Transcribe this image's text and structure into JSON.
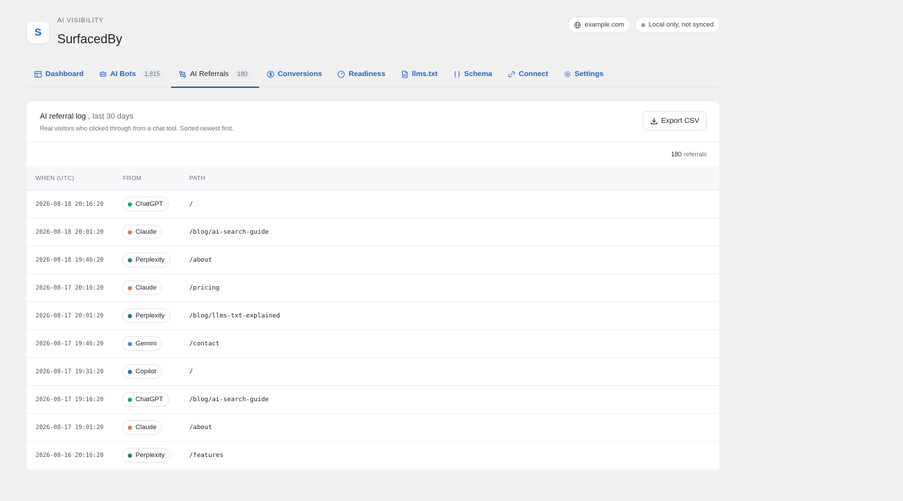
{
  "header": {
    "logo_letter": "S",
    "eyebrow": "AI VISIBILITY",
    "brand": "SurfacedBy",
    "domain_chip": "example.com",
    "sync_chip": "Local only, not synced"
  },
  "tabs": [
    {
      "label": "Dashboard",
      "icon": "layout-icon"
    },
    {
      "label": "AI Bots",
      "count": "1,815",
      "icon": "bot-icon"
    },
    {
      "label": "AI Referrals",
      "count": "180",
      "icon": "referral-icon",
      "active": true
    },
    {
      "label": "Conversions",
      "icon": "dollar-icon"
    },
    {
      "label": "Readiness",
      "icon": "gauge-icon"
    },
    {
      "label": "llms.txt",
      "icon": "file-icon"
    },
    {
      "label": "Schema",
      "icon": "braces-icon"
    },
    {
      "label": "Connect",
      "icon": "link-icon"
    },
    {
      "label": "Settings",
      "icon": "gear-icon"
    }
  ],
  "card": {
    "title": "AI referral log",
    "title_suffix": ", last 30 days",
    "description": "Real visitors who clicked through from a chat tool. Sorted newest first.",
    "export_label": "Export CSV",
    "count_value": "180",
    "count_label": "referrals"
  },
  "table": {
    "headers": {
      "when": "WHEN (UTC)",
      "from": "FROM",
      "path": "PATH"
    },
    "rows": [
      {
        "when": "2026-08-18 20:16:20",
        "from": "ChatGPT",
        "path": "/"
      },
      {
        "when": "2026-08-18 20:01:20",
        "from": "Claude",
        "path": "/blog/ai-search-guide"
      },
      {
        "when": "2026-08-18 19:46:20",
        "from": "Perplexity",
        "path": "/about"
      },
      {
        "when": "2026-08-17 20:16:20",
        "from": "Claude",
        "path": "/pricing"
      },
      {
        "when": "2026-08-17 20:01:20",
        "from": "Perplexity",
        "path": "/blog/llms-txt-explained"
      },
      {
        "when": "2026-08-17 19:46:20",
        "from": "Gemini",
        "path": "/contact"
      },
      {
        "when": "2026-08-17 19:31:20",
        "from": "Copilot",
        "path": "/"
      },
      {
        "when": "2026-08-17 19:16:20",
        "from": "ChatGPT",
        "path": "/blog/ai-search-guide"
      },
      {
        "when": "2026-08-17 19:01:20",
        "from": "Claude",
        "path": "/about"
      },
      {
        "when": "2026-08-16 20:16:20",
        "from": "Perplexity",
        "path": "/features"
      }
    ]
  },
  "source_colors": {
    "ChatGPT": "#10a37f",
    "Claude": "#d97757",
    "Perplexity": "#1f7a80",
    "Gemini": "#4f7fe0",
    "Copilot": "#0b78d0"
  },
  "colors": {
    "accent": "#2563c9"
  }
}
